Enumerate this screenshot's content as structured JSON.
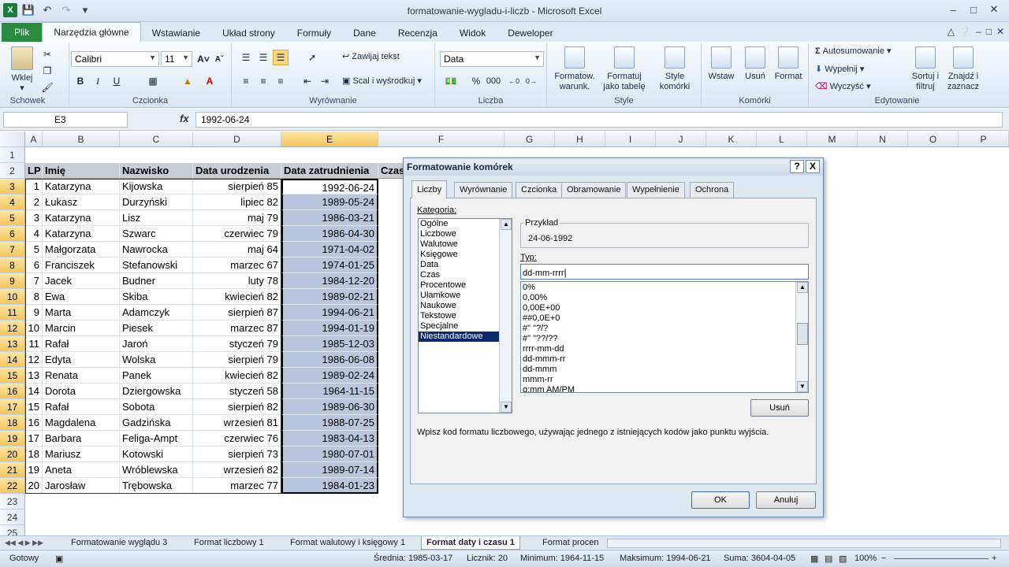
{
  "window": {
    "title": "formatowanie-wygladu-i-liczb  -  Microsoft Excel"
  },
  "ribbon_tabs": [
    "Plik",
    "Narzędzia główne",
    "Wstawianie",
    "Układ strony",
    "Formuły",
    "Dane",
    "Recenzja",
    "Widok",
    "Deweloper"
  ],
  "ribbon": {
    "clipboard": {
      "paste": "Wklej",
      "group": "Schowek"
    },
    "font": {
      "name": "Calibri",
      "size": "11",
      "group": "Czcionka",
      "bold": "B",
      "italic": "I",
      "underline": "U"
    },
    "alignment": {
      "wrap": "Zawijaj tekst",
      "merge": "Scal i wyśrodkuj",
      "group": "Wyrównanie"
    },
    "number": {
      "format": "Data",
      "percent": "%",
      "thousands": "000",
      "group": "Liczba"
    },
    "styles": {
      "cond": "Formatow. warunk.",
      "table": "Formatuj jako tabelę",
      "cell": "Style komórki",
      "group": "Style"
    },
    "cells": {
      "insert": "Wstaw",
      "delete": "Usuń",
      "format": "Format",
      "group": "Komórki"
    },
    "editing": {
      "autosum": "Autosumowanie",
      "fill": "Wypełnij",
      "clear": "Wyczyść",
      "sort": "Sortuj i filtruj",
      "find": "Znajdź i zaznacz",
      "group": "Edytowanie"
    }
  },
  "formula_bar": {
    "name_box": "E3",
    "fx": "fx",
    "value": "1992-06-24"
  },
  "columns": [
    "A",
    "B",
    "C",
    "D",
    "E",
    "F",
    "G",
    "H",
    "I",
    "J",
    "K",
    "L",
    "M",
    "N",
    "O",
    "P"
  ],
  "rows": [
    "1",
    "2",
    "3",
    "4",
    "5",
    "6",
    "7",
    "8",
    "9",
    "10",
    "11",
    "12",
    "13",
    "14",
    "15",
    "16",
    "17",
    "18",
    "19",
    "20",
    "21",
    "22",
    "23",
    "24",
    "25"
  ],
  "table": {
    "headers": [
      "LP",
      "Imię",
      "Nazwisko",
      "Data urodzenia",
      "Data zatrudnienia",
      "Czas"
    ],
    "rows": [
      [
        "1",
        "Katarzyna",
        "Kijowska",
        "sierpień 85",
        "1992-06-24"
      ],
      [
        "2",
        "Łukasz",
        "Durzyński",
        "lipiec 82",
        "1989-05-24"
      ],
      [
        "3",
        "Katarzyna",
        "Lisz",
        "maj 79",
        "1986-03-21"
      ],
      [
        "4",
        "Katarzyna",
        "Szwarc",
        "czerwiec 79",
        "1986-04-30"
      ],
      [
        "5",
        "Małgorzata",
        "Nawrocka",
        "maj 64",
        "1971-04-02"
      ],
      [
        "6",
        "Franciszek",
        "Stefanowski",
        "marzec 67",
        "1974-01-25"
      ],
      [
        "7",
        "Jacek",
        "Budner",
        "luty 78",
        "1984-12-20"
      ],
      [
        "8",
        "Ewa",
        "Skiba",
        "kwiecień 82",
        "1989-02-21"
      ],
      [
        "9",
        "Marta",
        "Adamczyk",
        "sierpień 87",
        "1994-06-21"
      ],
      [
        "10",
        "Marcin",
        "Piesek",
        "marzec 87",
        "1994-01-19"
      ],
      [
        "11",
        "Rafał",
        "Jaroń",
        "styczeń 79",
        "1985-12-03"
      ],
      [
        "12",
        "Edyta",
        "Wolska",
        "sierpień 79",
        "1986-06-08"
      ],
      [
        "13",
        "Renata",
        "Panek",
        "kwiecień 82",
        "1989-02-24"
      ],
      [
        "14",
        "Dorota",
        "Dziergowska",
        "styczeń 58",
        "1964-11-15"
      ],
      [
        "15",
        "Rafał",
        "Sobota",
        "sierpień 82",
        "1989-06-30"
      ],
      [
        "16",
        "Magdalena",
        "Gadzińska",
        "wrzesień 81",
        "1988-07-25"
      ],
      [
        "17",
        "Barbara",
        "Feliga-Ampt",
        "czerwiec 76",
        "1983-04-13"
      ],
      [
        "18",
        "Mariusz",
        "Kotowski",
        "sierpień 73",
        "1980-07-01"
      ],
      [
        "19",
        "Aneta",
        "Wróblewska",
        "wrzesień 82",
        "1989-07-14"
      ],
      [
        "20",
        "Jarosław",
        "Trębowska",
        "marzec 77",
        "1984-01-23"
      ]
    ]
  },
  "dialog": {
    "title": "Formatowanie komórek",
    "help": "?",
    "close": "X",
    "tabs": [
      "Liczby",
      "Wyrównanie",
      "Czcionka",
      "Obramowanie",
      "Wypełnienie",
      "Ochrona"
    ],
    "category_label": "Kategoria:",
    "categories": [
      "Ogólne",
      "Liczbowe",
      "Walutowe",
      "Księgowe",
      "Data",
      "Czas",
      "Procentowe",
      "Ułamkowe",
      "Naukowe",
      "Tekstowe",
      "Specjalne",
      "Niestandardowe"
    ],
    "selected_category": "Niestandardowe",
    "sample_label": "Przykład",
    "sample_value": "24-06-1992",
    "type_label": "Typ:",
    "type_value": "dd-mm-rrrr",
    "formats": [
      "0%",
      "0,00%",
      "0,00E+00",
      "##0,0E+0",
      "#\" \"?/?",
      "#\" \"??/??",
      "rrrr-mm-dd",
      "dd-mmm-rr",
      "dd-mmm",
      "mmm-rr",
      "g:mm AM/PM"
    ],
    "delete_button": "Usuń",
    "hint": "Wpisz kod formatu liczbowego, używając jednego z istniejących kodów jako punktu wyjścia.",
    "ok": "OK",
    "cancel": "Anuluj"
  },
  "sheets": [
    "Formatowanie wyglądu 3",
    "Format liczbowy 1",
    "Format walutowy i księgowy 1",
    "Format daty i czasu 1",
    "Format procen"
  ],
  "active_sheet": "Format daty i czasu 1",
  "status": {
    "mode": "Gotowy",
    "average": "Średnia: 1985-03-17",
    "count": "Licznik: 20",
    "min": "Minimum: 1964-11-15",
    "max": "Maksimum: 1994-06-21",
    "sum": "Suma: 3604-04-05",
    "zoom": "100%"
  }
}
